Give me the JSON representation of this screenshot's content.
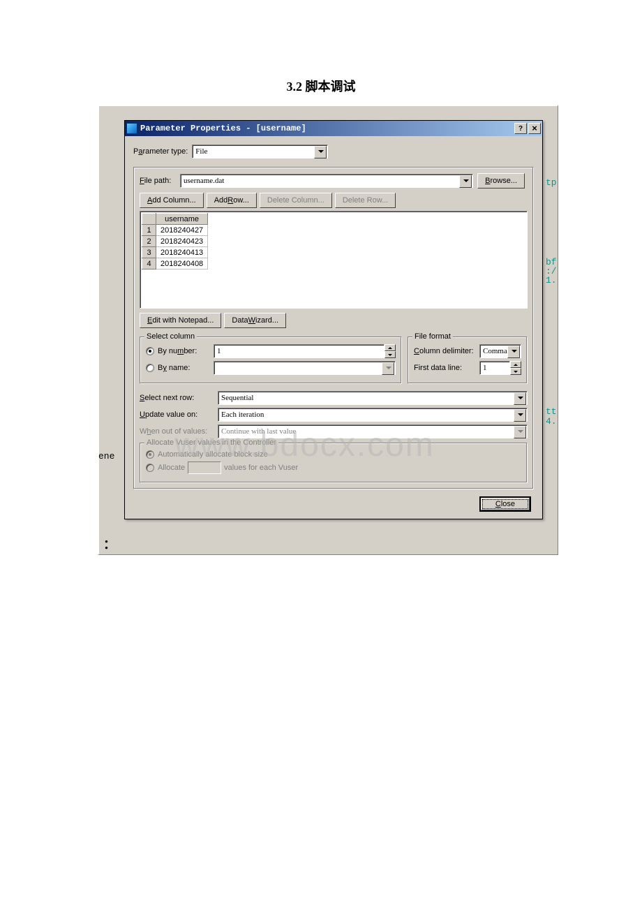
{
  "heading": "3.2 脚本调试",
  "titlebar": {
    "title": "Parameter Properties - [username]",
    "help_symbol": "?",
    "close_symbol": "×"
  },
  "parameter_type": {
    "label_prefix": "P",
    "label_und": "a",
    "label_suffix": "rameter type:",
    "value": "File"
  },
  "file_path": {
    "label_und": "F",
    "label_suffix": "ile path:",
    "value": "username.dat",
    "browse_und": "B",
    "browse_suffix": "rowse..."
  },
  "grid_buttons": {
    "add_col_und": "A",
    "add_col_suffix": "dd Column...",
    "add_row_prefix": "Add ",
    "add_row_und": "R",
    "add_row_suffix": "ow...",
    "del_col": "Delete Column...",
    "del_row": "Delete Row..."
  },
  "grid": {
    "header": "username",
    "rows": [
      {
        "n": "1",
        "v": "2018240427"
      },
      {
        "n": "2",
        "v": "2018240423"
      },
      {
        "n": "3",
        "v": "2018240413"
      },
      {
        "n": "4",
        "v": "2018240408"
      }
    ]
  },
  "edit_notepad": {
    "und": "E",
    "suffix": "dit with Notepad..."
  },
  "data_wizard": {
    "prefix": "Data ",
    "und": "W",
    "suffix": "izard..."
  },
  "select_column": {
    "legend": "Select column",
    "by_number_prefix": "By nu",
    "by_number_und": "m",
    "by_number_suffix": "ber:",
    "by_name_prefix": "B",
    "by_name_und": "y",
    "by_name_suffix": " name:",
    "number_value": "1"
  },
  "file_format": {
    "legend": "File format",
    "col_delim_und": "C",
    "col_delim_suffix": "olumn delimiter:",
    "col_delim_value": "Comma",
    "first_line_label": "First data line:",
    "first_line_value": "1"
  },
  "select_next_row": {
    "und": "S",
    "suffix": "elect next row:",
    "value": "Sequential"
  },
  "update_value": {
    "und": "U",
    "suffix": "pdate value on:",
    "value": "Each iteration"
  },
  "when_out": {
    "prefix": "W",
    "und": "h",
    "suffix": "en out of values:",
    "value": "Continue with last value"
  },
  "allocate": {
    "legend": "Allocate Vuser values in the Controller",
    "auto_label": "Automatically allocate block size",
    "alloc_label": "Allocate",
    "alloc_suffix": "values for each Vuser"
  },
  "close_btn": {
    "und": "C",
    "suffix": "lose"
  },
  "bg": {
    "t1": "tp",
    "t2": "bf",
    "t3": ":/",
    "t4": "1.",
    "t5": "tt",
    "t6": "4.",
    "t7": "ene"
  },
  "watermark": "www.bdocx.com",
  "colon": "："
}
